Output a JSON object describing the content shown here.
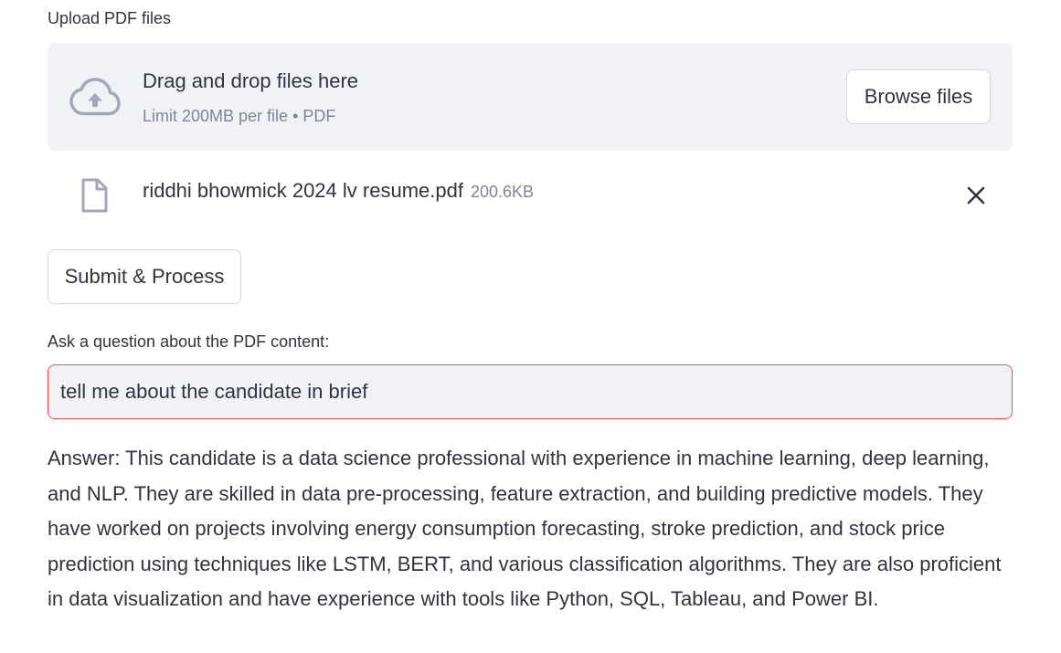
{
  "uploader": {
    "label": "Upload PDF files",
    "dropzone_title": "Drag and drop files here",
    "dropzone_subtitle": "Limit 200MB per file • PDF",
    "browse_label": "Browse files",
    "cloud_icon": "cloud-upload-icon"
  },
  "uploaded_file": {
    "name": "riddhi bhowmick 2024 lv resume.pdf",
    "size": "200.6KB",
    "file_icon": "file-icon",
    "remove_icon": "close-icon"
  },
  "submit_label": "Submit & Process",
  "question": {
    "label": "Ask a question about the PDF content:",
    "value": "tell me about the candidate in brief"
  },
  "answer": "Answer: This candidate is a data science professional with experience in machine learning, deep learning, and NLP. They are skilled in data pre-processing, feature extraction, and building predictive models. They have worked on projects involving energy consumption forecasting, stroke prediction, and stock price prediction using techniques like LSTM, BERT, and various classification algorithms. They are also proficient in data visualization and have experience with tools like Python, SQL, Tableau, and Power BI.",
  "colors": {
    "text": "#31333f",
    "muted": "#818495",
    "input_bg": "#f0f2f6",
    "focus_border": "#ff4b4b",
    "icon": "#a3a8b8"
  }
}
